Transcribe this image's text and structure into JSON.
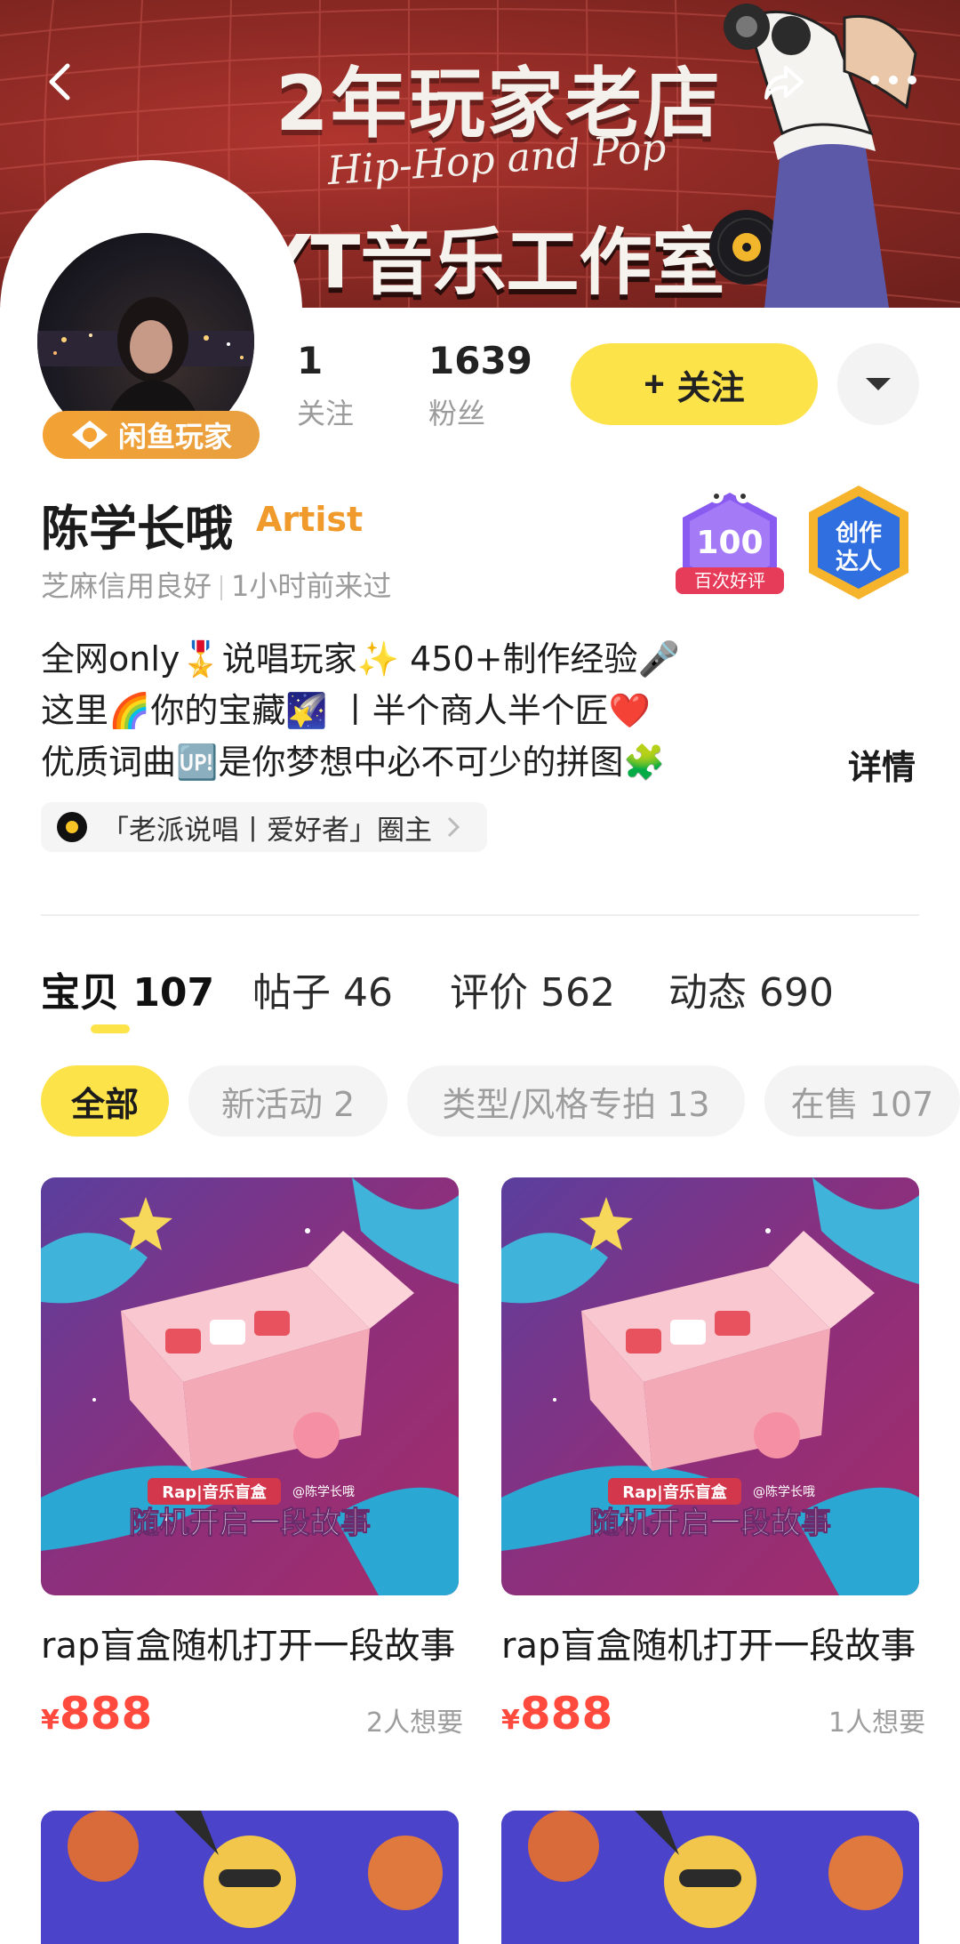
{
  "banner": {
    "title": "2年玩家老店",
    "script_text": "Hip-Hop and Pop",
    "studio_name": "YT音乐工作室"
  },
  "profile": {
    "player_badge": "闲鱼玩家",
    "following_count": "1",
    "following_label": "关注",
    "fans_count": "1639",
    "fans_label": "粉丝",
    "follow_button": "关注",
    "name": "陈学长哦",
    "role_tag": "Artist",
    "credit": "芝麻信用良好",
    "last_seen": "1小时前来过",
    "badge_reviews_number": "100",
    "badge_reviews_label": "百次好评",
    "badge_creator_label": "创作达人"
  },
  "bio": {
    "line1": "全网only🎖️说唱玩家✨ 450+制作经验🎤",
    "line2": "这里🌈你的宝藏🌠 丨半个商人半个匠❤️",
    "line3": "优质词曲🆙是你梦想中必不可少的拼图🧩",
    "detail_link": "详情",
    "circle_chip": "「老派说唱丨爱好者」圈主"
  },
  "tabs": [
    {
      "label": "宝贝 107"
    },
    {
      "label": "帖子 46"
    },
    {
      "label": "评价 562"
    },
    {
      "label": "动态 690"
    }
  ],
  "filters": [
    {
      "label": "全部"
    },
    {
      "label": "新活动 2"
    },
    {
      "label": "类型/风格专拍 13"
    },
    {
      "label": "在售 107"
    }
  ],
  "products": [
    {
      "title": "rap盲盒随机打开一段故事",
      "currency": "¥",
      "price": "888",
      "wants": "2人想要",
      "image_caption_tag": "Rap|音乐盲盒",
      "image_caption_user": "@陈学长哦",
      "image_caption_main": "随机开启一段故事"
    },
    {
      "title": "rap盲盒随机打开一段故事",
      "currency": "¥",
      "price": "888",
      "wants": "1人想要",
      "image_caption_tag": "Rap|音乐盲盒",
      "image_caption_user": "@陈学长哦",
      "image_caption_main": "随机开启一段故事"
    }
  ],
  "colors": {
    "accent_yellow": "#fde34a",
    "price_red": "#ff4a3d",
    "artist_orange": "#ef9a2a",
    "banner_red": "#8f2a25"
  },
  "icons": [
    "back-arrow-icon",
    "share-icon",
    "more-dots-icon",
    "chevron-down-icon",
    "plus-icon",
    "chevron-right-icon",
    "vinyl-icon",
    "crown-icon"
  ]
}
